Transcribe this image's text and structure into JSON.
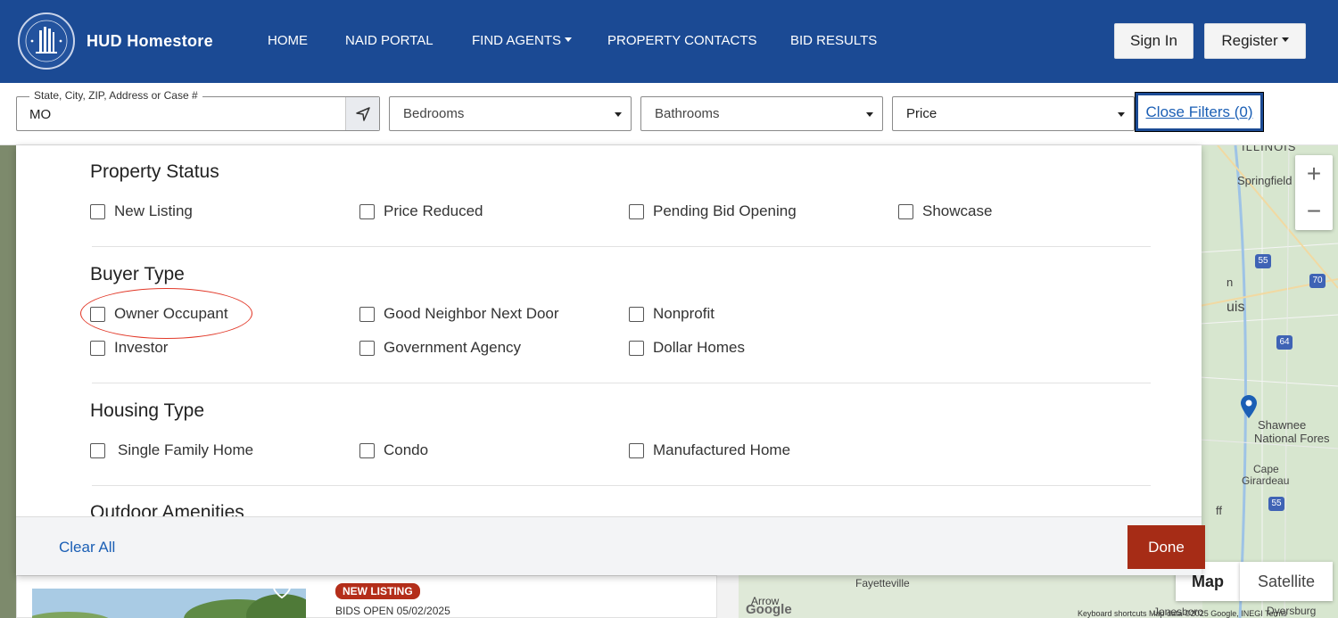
{
  "header": {
    "brand": "HUD Homestore",
    "nav": [
      {
        "label": "HOME"
      },
      {
        "label": "NAID PORTAL"
      },
      {
        "label": "FIND AGENTS",
        "dropdown": true
      },
      {
        "label": "PROPERTY CONTACTS"
      },
      {
        "label": "BID RESULTS"
      }
    ],
    "sign_in": "Sign In",
    "register": "Register",
    "colors": {
      "header_bg": "#1b4a94"
    }
  },
  "filters": {
    "search": {
      "legend": "State, City, ZIP, Address or Case #",
      "value": "MO",
      "locate_icon": "location-arrow-icon"
    },
    "bedrooms": "Bedrooms",
    "bathrooms": "Bathrooms",
    "price": "Price",
    "close_filters": "Close Filters (0)"
  },
  "panel": {
    "sections": [
      {
        "title": "Property Status",
        "options": [
          "New Listing",
          "Price Reduced",
          "Pending Bid Opening",
          "Showcase"
        ]
      },
      {
        "title": "Buyer Type",
        "options": [
          "Owner Occupant",
          "Good Neighbor Next Door",
          "Nonprofit",
          "Investor",
          "Government Agency",
          "Dollar Homes"
        ]
      },
      {
        "title": "Housing Type",
        "options": [
          "Single Family Home",
          "Condo",
          "Manufactured Home"
        ]
      },
      {
        "title": "Outdoor Amenities"
      }
    ],
    "clear_all": "Clear All",
    "done": "Done",
    "colors": {
      "done_bg": "#a62c16",
      "annotation": "#e23a2a"
    }
  },
  "map": {
    "labels": [
      "ILLINOIS",
      "Springfield",
      "n",
      "uis",
      "Shawnee",
      "National Fores",
      "Cape",
      "Girardeau",
      "ff",
      "Fayetteville",
      "Arrow",
      "Jonesboro",
      "Dyersburg"
    ],
    "highways": [
      "55",
      "70",
      "64",
      "55"
    ],
    "zoom_in": "+",
    "zoom_out": "−",
    "map_btn": "Map",
    "satellite_btn": "Satellite",
    "attribution": "Keyboard shortcuts   Map data ©2025 Google, INEGI   Terms",
    "google": "Google"
  },
  "listing": {
    "badge": "NEW LISTING",
    "bids_open": "BIDS OPEN 05/02/2025"
  }
}
